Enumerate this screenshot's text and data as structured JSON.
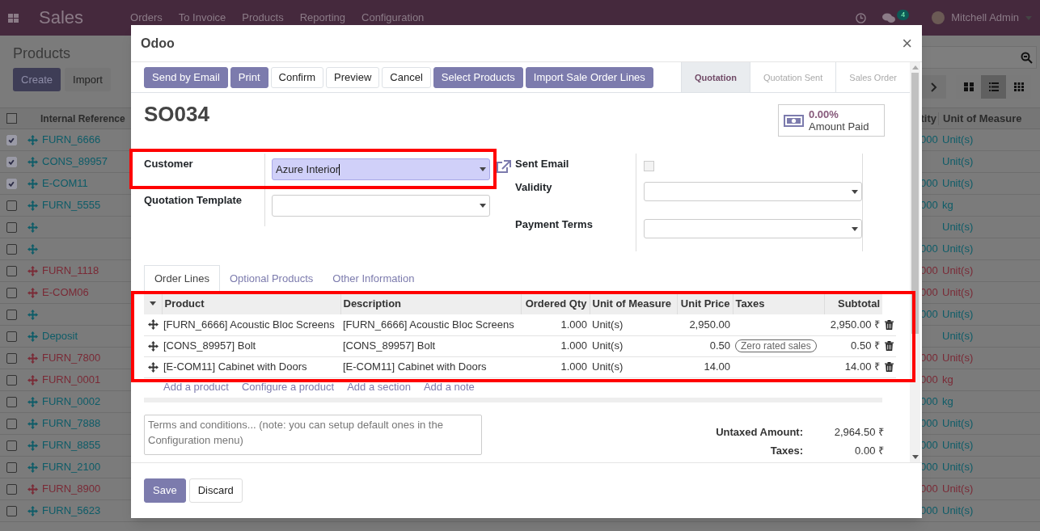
{
  "app": {
    "name": "Sales",
    "menu": [
      "Orders",
      "To Invoice",
      "Products",
      "Reporting",
      "Configuration"
    ],
    "chat_count": "4",
    "user": "Mitchell Admin"
  },
  "page": {
    "title": "Products",
    "buttons": [
      "Create",
      "Import"
    ],
    "all_checked": false,
    "views": [
      {
        "selected": false
      },
      {
        "selected": true
      },
      {
        "selected": false
      }
    ],
    "columns": [
      "Internal Reference",
      "tity",
      "Unit of Measure"
    ],
    "rows": [
      {
        "checked": true,
        "reference": "FURN_6666",
        "qty": "000",
        "uom": "Unit(s)",
        "color": "#0d5c68"
      },
      {
        "checked": true,
        "reference": "CONS_89957",
        "qty": "",
        "uom": "Unit(s)",
        "color": "#0d5c68"
      },
      {
        "checked": true,
        "reference": "E-COM11",
        "qty": "000",
        "uom": "Unit(s)",
        "color": "#0d5c68"
      },
      {
        "checked": false,
        "reference": "FURN_5555",
        "qty": "000",
        "uom": "kg",
        "color": "#0d5c68"
      },
      {
        "checked": false,
        "reference": "",
        "qty": "",
        "uom": "Unit(s)",
        "color": "#0d5c68"
      },
      {
        "checked": false,
        "reference": "",
        "qty": "000",
        "uom": "Unit(s)",
        "color": "#0d5c68"
      },
      {
        "checked": false,
        "reference": "FURN_1118",
        "qty": "000",
        "uom": "Unit(s)",
        "color": "#7a2a36"
      },
      {
        "checked": false,
        "reference": "E-COM06",
        "qty": "000",
        "uom": "Unit(s)",
        "color": "#7a2a36"
      },
      {
        "checked": false,
        "reference": "",
        "qty": "000",
        "uom": "Unit(s)",
        "color": "#0d5c68"
      },
      {
        "checked": false,
        "reference": "Deposit",
        "qty": "",
        "uom": "Unit(s)",
        "color": "#0d5c68"
      },
      {
        "checked": false,
        "reference": "FURN_7800",
        "qty": "000",
        "uom": "Unit(s)",
        "color": "#7a2a36"
      },
      {
        "checked": false,
        "reference": "FURN_0001",
        "qty": "000",
        "uom": "kg",
        "color": "#7a2a36"
      },
      {
        "checked": false,
        "reference": "FURN_0002",
        "qty": "000",
        "uom": "kg",
        "color": "#0d5c68"
      },
      {
        "checked": false,
        "reference": "FURN_7888",
        "qty": "000",
        "uom": "Unit(s)",
        "color": "#0d5c68"
      },
      {
        "checked": false,
        "reference": "FURN_8855",
        "qty": "000",
        "uom": "Unit(s)",
        "color": "#0d5c68"
      },
      {
        "checked": false,
        "reference": "FURN_2100",
        "qty": "000",
        "uom": "Unit(s)",
        "color": "#0d5c68"
      },
      {
        "checked": false,
        "reference": "FURN_8900",
        "qty": "000",
        "uom": "Unit(s)",
        "color": "#7a2a36"
      },
      {
        "checked": false,
        "reference": "FURN_5623",
        "qty": "000",
        "uom": "Unit(s)",
        "color": "#0d5c68"
      }
    ]
  },
  "modal": {
    "title": "Odoo",
    "close": "×",
    "buttons": [
      {
        "label": "Send by Email",
        "primary": true
      },
      {
        "label": "Print",
        "primary": true
      },
      {
        "label": "Confirm",
        "primary": false
      },
      {
        "label": "Preview",
        "primary": false
      },
      {
        "label": "Cancel",
        "primary": false
      },
      {
        "label": "Select Products",
        "primary": true
      },
      {
        "label": "Import Sale Order Lines",
        "primary": true
      }
    ],
    "stages": [
      {
        "label": "Quotation",
        "selected": true
      },
      {
        "label": "Quotation Sent",
        "selected": false
      },
      {
        "label": "Sales Order",
        "selected": false
      }
    ],
    "order": "SO034",
    "amount_paid": {
      "value": "0.00%",
      "label": "Amount Paid"
    },
    "left_fields": [
      {
        "label": "Customer",
        "value": "Azure Interior",
        "focused": true
      },
      {
        "label": "Quotation Template",
        "focused": false
      }
    ],
    "right_fields": [
      {
        "label": "Sent Email",
        "kind": "checkbox",
        "checked": false
      },
      {
        "label": "Validity",
        "kind": "select"
      },
      {
        "label": "Payment Terms",
        "kind": "select"
      }
    ],
    "tabs": [
      {
        "label": "Order Lines",
        "selected": true
      },
      {
        "label": "Optional Products",
        "selected": false
      },
      {
        "label": "Other Information",
        "selected": false
      }
    ],
    "line_columns": [
      "Product",
      "Description",
      "Ordered Qty",
      "Unit of Measure",
      "Unit Price",
      "Taxes",
      "Subtotal"
    ],
    "lines": [
      {
        "product": "[FURN_6666] Acoustic Bloc Screens",
        "description": "[FURN_6666] Acoustic Bloc Screens",
        "qty": "1.000",
        "uom": "Unit(s)",
        "price": "2,950.00",
        "subtotal": "2,950.00 ₹"
      },
      {
        "product": "[CONS_89957] Bolt",
        "description": "[CONS_89957] Bolt",
        "qty": "1.000",
        "uom": "Unit(s)",
        "price": "0.50",
        "tax": "Zero rated sales",
        "subtotal": "0.50 ₹"
      },
      {
        "product": "[E-COM11] Cabinet with Doors",
        "description": "[E-COM11] Cabinet with Doors",
        "qty": "1.000",
        "uom": "Unit(s)",
        "price": "14.00",
        "subtotal": "14.00 ₹"
      }
    ],
    "add_links": [
      "Add a product",
      "Configure a product",
      "Add a section",
      "Add a note"
    ],
    "terms_placeholder": "Terms and conditions... (note: you can setup default ones in the Configuration menu)",
    "totals": [
      {
        "label": "Untaxed Amount:",
        "value": "2,964.50 ₹"
      },
      {
        "label": "Taxes:",
        "value": "0.00 ₹"
      }
    ],
    "footer_buttons": [
      {
        "label": "Save",
        "primary": true
      },
      {
        "label": "Discard",
        "primary": false
      }
    ]
  }
}
